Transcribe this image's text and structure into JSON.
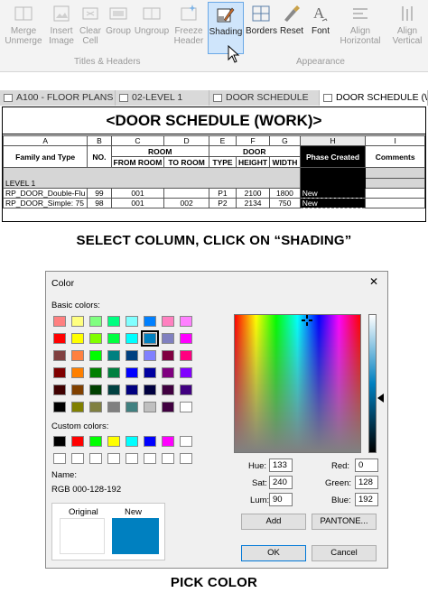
{
  "ribbon": {
    "buttons": [
      {
        "label": "Merge\nUnmerge",
        "icon": "merge-icon"
      },
      {
        "label": "Insert\nImage",
        "icon": "insert-image-icon"
      },
      {
        "label": "Clear\nCell",
        "icon": "clear-cell-icon"
      },
      {
        "label": "Group",
        "icon": "group-icon"
      },
      {
        "label": "Ungroup",
        "icon": "ungroup-icon"
      },
      {
        "label": "Freeze\nHeader",
        "icon": "freeze-header-icon"
      },
      {
        "label": "Shading",
        "icon": "shading-icon"
      },
      {
        "label": "Borders",
        "icon": "borders-icon"
      },
      {
        "label": "Reset",
        "icon": "reset-icon"
      },
      {
        "label": "Font",
        "icon": "font-icon"
      },
      {
        "label": "Align\nHorizontal",
        "icon": "align-horizontal-icon"
      },
      {
        "label": "Align\nVertical",
        "icon": "align-vertical-icon"
      }
    ],
    "group_titles": "Titles & Headers",
    "group_appearance": "Appearance"
  },
  "tabs": [
    "A100 - FLOOR PLANS",
    "02-LEVEL 1",
    "DOOR SCHEDULE",
    "DOOR SCHEDULE (WORK)"
  ],
  "schedule": {
    "title": "<DOOR SCHEDULE (WORK)>",
    "col_letters": [
      "A",
      "B",
      "C",
      "D",
      "E",
      "F",
      "G",
      "H",
      "I"
    ],
    "group_room": "ROOM",
    "group_door": "DOOR",
    "headers": [
      "Family and Type",
      "NO.",
      "FROM ROOM",
      "TO ROOM",
      "TYPE",
      "HEIGHT",
      "WIDTH",
      "Phase Created",
      "Comments"
    ],
    "level": "LEVEL 1",
    "rows": [
      [
        "RP_DOOR_Double-Flu",
        "99",
        "001",
        "",
        "P1",
        "2100",
        "1800",
        "New",
        ""
      ],
      [
        "RP_DOOR_Simple: 75",
        "98",
        "001",
        "002",
        "P2",
        "2134",
        "750",
        "New",
        ""
      ]
    ]
  },
  "caption1": "SELECT COLUMN, CLICK ON “SHADING”",
  "caption2": "PICK COLOR",
  "dialog": {
    "title": "Color",
    "close": "✕",
    "basic_label": "Basic colors:",
    "custom_label": "Custom colors:",
    "name_label": "Name:",
    "name_value": "RGB 000-128-192",
    "original_label": "Original",
    "new_label": "New",
    "hue_label": "Hue:",
    "hue": "133",
    "sat_label": "Sat:",
    "sat": "240",
    "lum_label": "Lum:",
    "lum": "90",
    "red_label": "Red:",
    "red": "0",
    "green_label": "Green:",
    "green": "128",
    "blue_label": "Blue:",
    "blue": "192",
    "add": "Add",
    "pantone": "PANTONE...",
    "ok": "OK",
    "cancel": "Cancel",
    "basic_colors": [
      "#ff8080",
      "#ffff80",
      "#80ff80",
      "#00ff80",
      "#80ffff",
      "#0080ff",
      "#ff80c0",
      "#ff80ff",
      "#ff0000",
      "#ffff00",
      "#80ff00",
      "#00ff40",
      "#00ffff",
      "#0080c0",
      "#8080c0",
      "#ff00ff",
      "#804040",
      "#ff8040",
      "#00ff00",
      "#008080",
      "#004080",
      "#8080ff",
      "#800040",
      "#ff0080",
      "#800000",
      "#ff8000",
      "#008000",
      "#008040",
      "#0000ff",
      "#0000a0",
      "#800080",
      "#8000ff",
      "#400000",
      "#804000",
      "#004000",
      "#004040",
      "#000080",
      "#000040",
      "#400040",
      "#400080",
      "#000000",
      "#808000",
      "#808040",
      "#808080",
      "#408080",
      "#c0c0c0",
      "#400040",
      "#ffffff"
    ],
    "custom_colors": [
      "#000000",
      "#ff0000",
      "#00ff00",
      "#ffff00",
      "#00ffff",
      "#0000ff",
      "#ff00ff",
      "#ffffff",
      "#ffffff",
      "#ffffff",
      "#ffffff",
      "#ffffff",
      "#ffffff",
      "#ffffff",
      "#ffffff",
      "#ffffff"
    ],
    "original_color": "#ffffff",
    "new_color": "#0080c0"
  }
}
